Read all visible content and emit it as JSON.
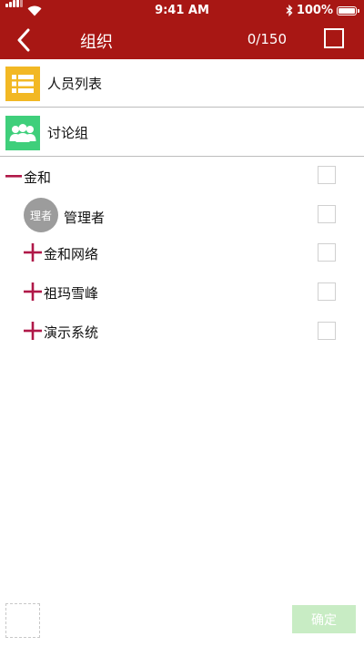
{
  "status_bar": {
    "time": "9:41 AM",
    "battery": "100%"
  },
  "nav": {
    "title": "组织",
    "count": "0/150"
  },
  "menu": [
    {
      "label": "人员列表",
      "icon": "list-icon",
      "color": "#f2b824"
    },
    {
      "label": "讨论组",
      "icon": "group-icon",
      "color": "#3fcf7b"
    }
  ],
  "tree": {
    "root": {
      "label": "金和",
      "expander": "minus-icon"
    },
    "admin": {
      "avatar_text": "理者",
      "label": "管理者"
    },
    "children": [
      {
        "label": "金和网络",
        "expander": "plus-icon"
      },
      {
        "label": "祖玛雪峰",
        "expander": "plus-icon"
      },
      {
        "label": "演示系统",
        "expander": "plus-icon"
      }
    ]
  },
  "colors": {
    "header": "#a81714",
    "expander": "#b01848",
    "confirm_disabled": "#c8ecc4"
  },
  "footer": {
    "confirm_label": "确定"
  }
}
